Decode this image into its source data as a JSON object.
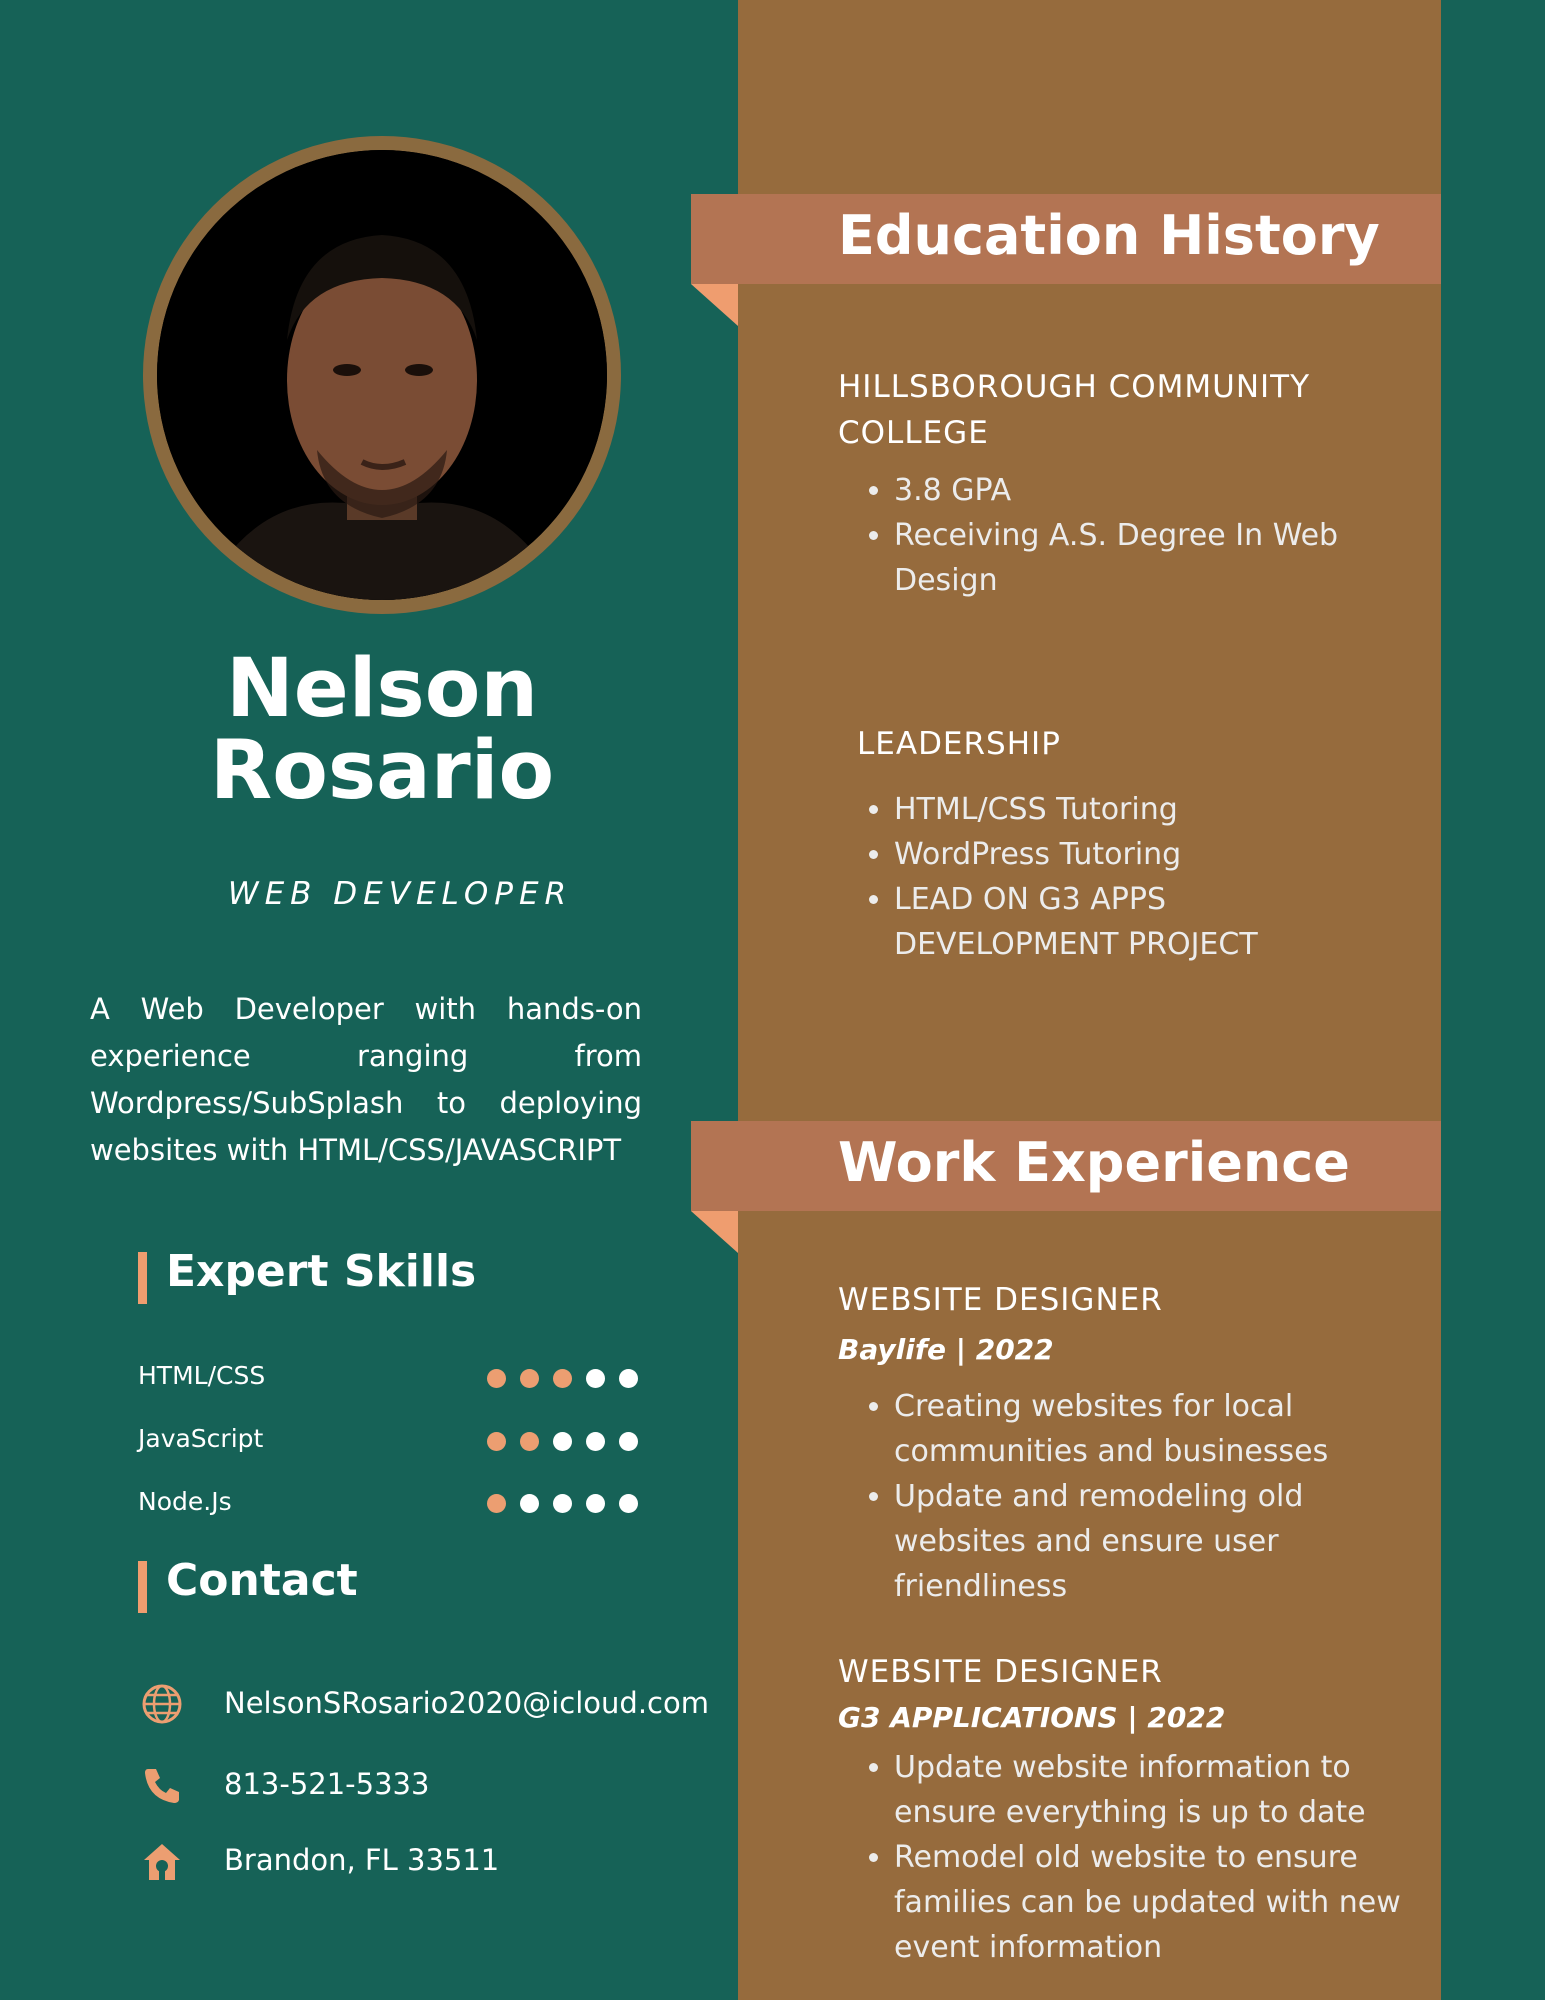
{
  "profile": {
    "name_first": "Nelson",
    "name_last": "Rosario",
    "role": "WEB DEVELOPER",
    "summary": "A Web Developer with hands-on experience ranging from Wordpress/SubSplash to deploying websites with HTML/CSS/JAVASCRIPT"
  },
  "skills": {
    "heading": "Expert Skills",
    "items": [
      {
        "label": "HTML/CSS",
        "level": 3,
        "max": 5
      },
      {
        "label": "JavaScript",
        "level": 2,
        "max": 5
      },
      {
        "label": "Node.Js",
        "level": 1,
        "max": 5
      }
    ]
  },
  "contact": {
    "heading": "Contact",
    "email": "NelsonSRosario2020@icloud.com",
    "phone": "813-521-5333",
    "address": "Brandon, FL 33511",
    "icons": [
      "globe-icon",
      "phone-icon",
      "home-icon"
    ]
  },
  "education": {
    "heading": "Education History",
    "school": "HILLSBOROUGH COMMUNITY COLLEGE",
    "school_points": [
      "3.8 GPA",
      "Receiving A.S. Degree In Web Design"
    ],
    "leadership_title": "LEADERSHIP",
    "leadership_points": [
      "HTML/CSS Tutoring",
      "WordPress Tutoring",
      "LEAD ON G3 APPS DEVELOPMENT PROJECT"
    ]
  },
  "work": {
    "heading": "Work Experience",
    "jobs": [
      {
        "title": "WEBSITE DESIGNER",
        "company": "Baylife | 2022",
        "points": [
          "Creating websites for local communities and businesses",
          "Update and remodeling old websites and ensure user friendliness"
        ]
      },
      {
        "title": "WEBSITE DESIGNER",
        "company": "G3 APPLICATIONS | 2022",
        "points": [
          "Update website information to ensure everything is up to date",
          "Remodel old website to ensure families can be updated with new event information"
        ]
      }
    ]
  },
  "colors": {
    "left_bg": "#166257",
    "right_bg": "#966b3d",
    "banner": "#b37453",
    "accent": "#ef9d6f"
  }
}
